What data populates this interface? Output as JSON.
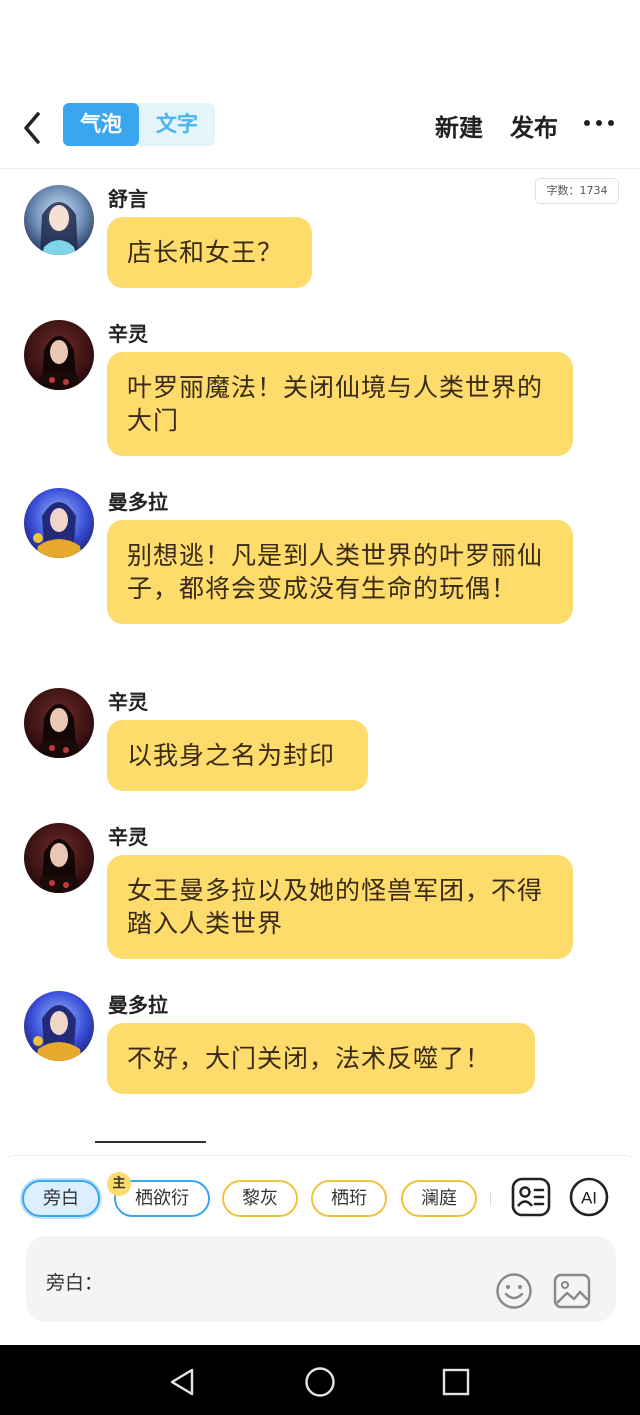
{
  "header": {
    "tabs": [
      {
        "label": "气泡",
        "active": true
      },
      {
        "label": "文字",
        "active": false
      }
    ],
    "new_label": "新建",
    "publish_label": "发布",
    "word_count": "字数：1734"
  },
  "messages": [
    {
      "name": "舒言",
      "text": "店长和女王？",
      "avatar": "shuyan-avatar"
    },
    {
      "name": "辛灵",
      "text": "叶罗丽魔法！关闭仙境与人类世界的大门",
      "avatar": "xinling-avatar"
    },
    {
      "name": "曼多拉",
      "text": "别想逃！凡是到人类世界的叶罗丽仙子，都将会变成没有生命的玩偶！",
      "avatar": "mandola-avatar"
    },
    {
      "name": "辛灵",
      "text": "以我身之名为封印",
      "avatar": "xinling-avatar"
    },
    {
      "name": "辛灵",
      "text": "女王曼多拉以及她的怪兽军团，不得踏入人类世界",
      "avatar": "xinling-avatar"
    },
    {
      "name": "曼多拉",
      "text": "不好，大门关闭，法术反噬了！",
      "avatar": "mandola-avatar"
    }
  ],
  "characters": [
    {
      "label": "旁白",
      "selected": true
    },
    {
      "label": "栖欲衍",
      "badge": "主"
    },
    {
      "label": "黎灰"
    },
    {
      "label": "栖珩"
    },
    {
      "label": "澜庭"
    }
  ],
  "input": {
    "label": "旁白："
  },
  "colors": {
    "accent": "#3aa6f0",
    "bubble": "#fddc6c",
    "chip_border": "#f0c33c"
  },
  "icons": [
    "back-arrow-icon",
    "more-dots-icon",
    "contact-card-icon",
    "ai-icon",
    "emoji-icon",
    "image-icon",
    "nav-back-icon",
    "nav-home-icon",
    "nav-recent-icon"
  ]
}
